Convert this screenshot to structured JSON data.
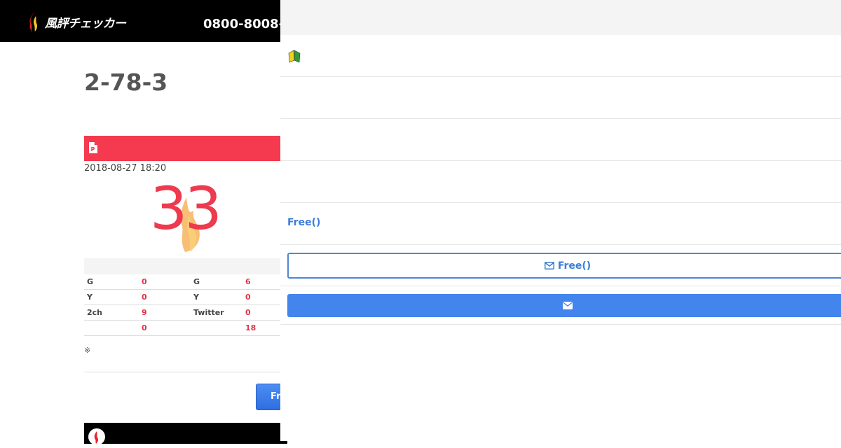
{
  "header": {
    "logo_text": "風評チェッカー",
    "phone": "0800-8008-"
  },
  "main": {
    "title": "2-78-3",
    "date": "2018-08-27 18:20",
    "score": "33",
    "stats": [
      {
        "l1": "G",
        "v1": "0",
        "l2": "G",
        "v2": "6"
      },
      {
        "l1": "Y",
        "v1": "0",
        "l2": "Y",
        "v2": "0"
      },
      {
        "l1": "2ch",
        "v1": "9",
        "l2": "Twitter",
        "v2": "0"
      },
      {
        "l1": "",
        "v1": "0",
        "l2": "",
        "v2": "18"
      }
    ],
    "note": "※",
    "free_button_label": "Fr"
  },
  "panel": {
    "free_link": "Free()",
    "free_button_label": "Free()"
  },
  "colors": {
    "accent_red": "#f5394f",
    "accent_blue": "#4285ec",
    "link_blue": "#3b7ed8"
  }
}
